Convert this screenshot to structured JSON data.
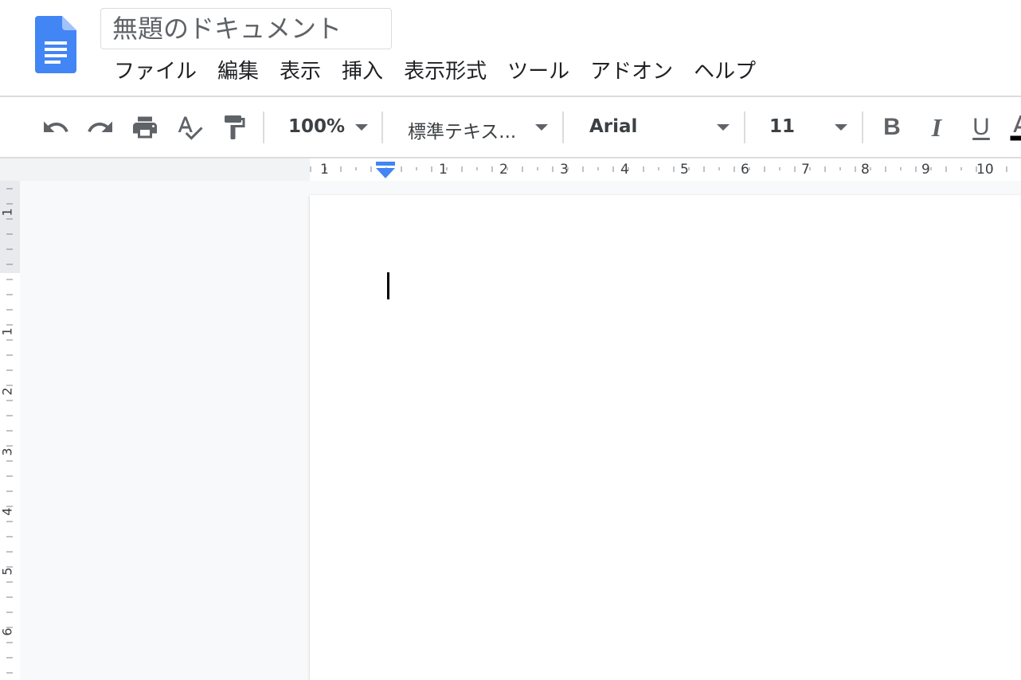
{
  "document": {
    "title": "無題のドキュメント"
  },
  "menu": {
    "items": [
      "ファイル",
      "編集",
      "表示",
      "挿入",
      "表示形式",
      "ツール",
      "アドオン",
      "ヘルプ"
    ]
  },
  "toolbar": {
    "undo_icon": "undo-icon",
    "redo_icon": "redo-icon",
    "print_icon": "print-icon",
    "spellcheck_icon": "spellcheck-icon",
    "paint_format_icon": "paint-format-icon",
    "zoom": "100%",
    "style": "標準テキス...",
    "font": "Arial",
    "font_size": "11",
    "bold_label": "B",
    "italic_label": "I",
    "underline_label": "U"
  },
  "ruler": {
    "horizontal_labels": [
      "1",
      "1",
      "2",
      "3",
      "4",
      "5",
      "6",
      "7",
      "8",
      "9",
      "10"
    ],
    "vertical_labels": [
      "1",
      "1",
      "2",
      "3",
      "4",
      "5",
      "6"
    ]
  },
  "colors": {
    "logo_blue": "#4285f4",
    "indent_marker": "#4285f4",
    "border": "#dadce0"
  }
}
